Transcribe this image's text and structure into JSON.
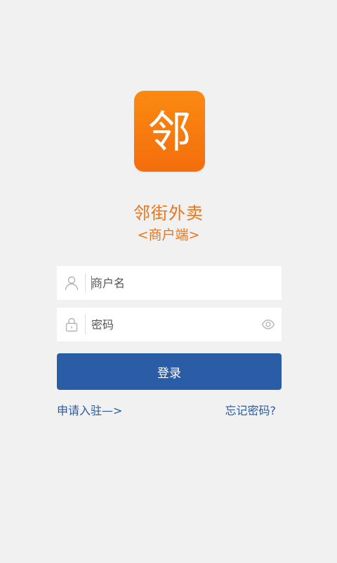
{
  "logo": {
    "glyph": "邻",
    "color": "#f47d0e"
  },
  "app": {
    "name": "邻街外卖",
    "subtitle": "<商户端>"
  },
  "login_form": {
    "username_placeholder": "商户名",
    "password_placeholder": "密码",
    "submit_label": "登录"
  },
  "links": {
    "apply": "申请入驻—>",
    "forgot_password": "忘记密码?"
  },
  "icons": {
    "username": "user-icon",
    "password": "lock-icon",
    "visibility": "eye-icon"
  },
  "colors": {
    "accent": "#e8761c",
    "primary_button": "#2b5da6",
    "link": "#2a5aa2",
    "background": "#f1f1f1"
  }
}
